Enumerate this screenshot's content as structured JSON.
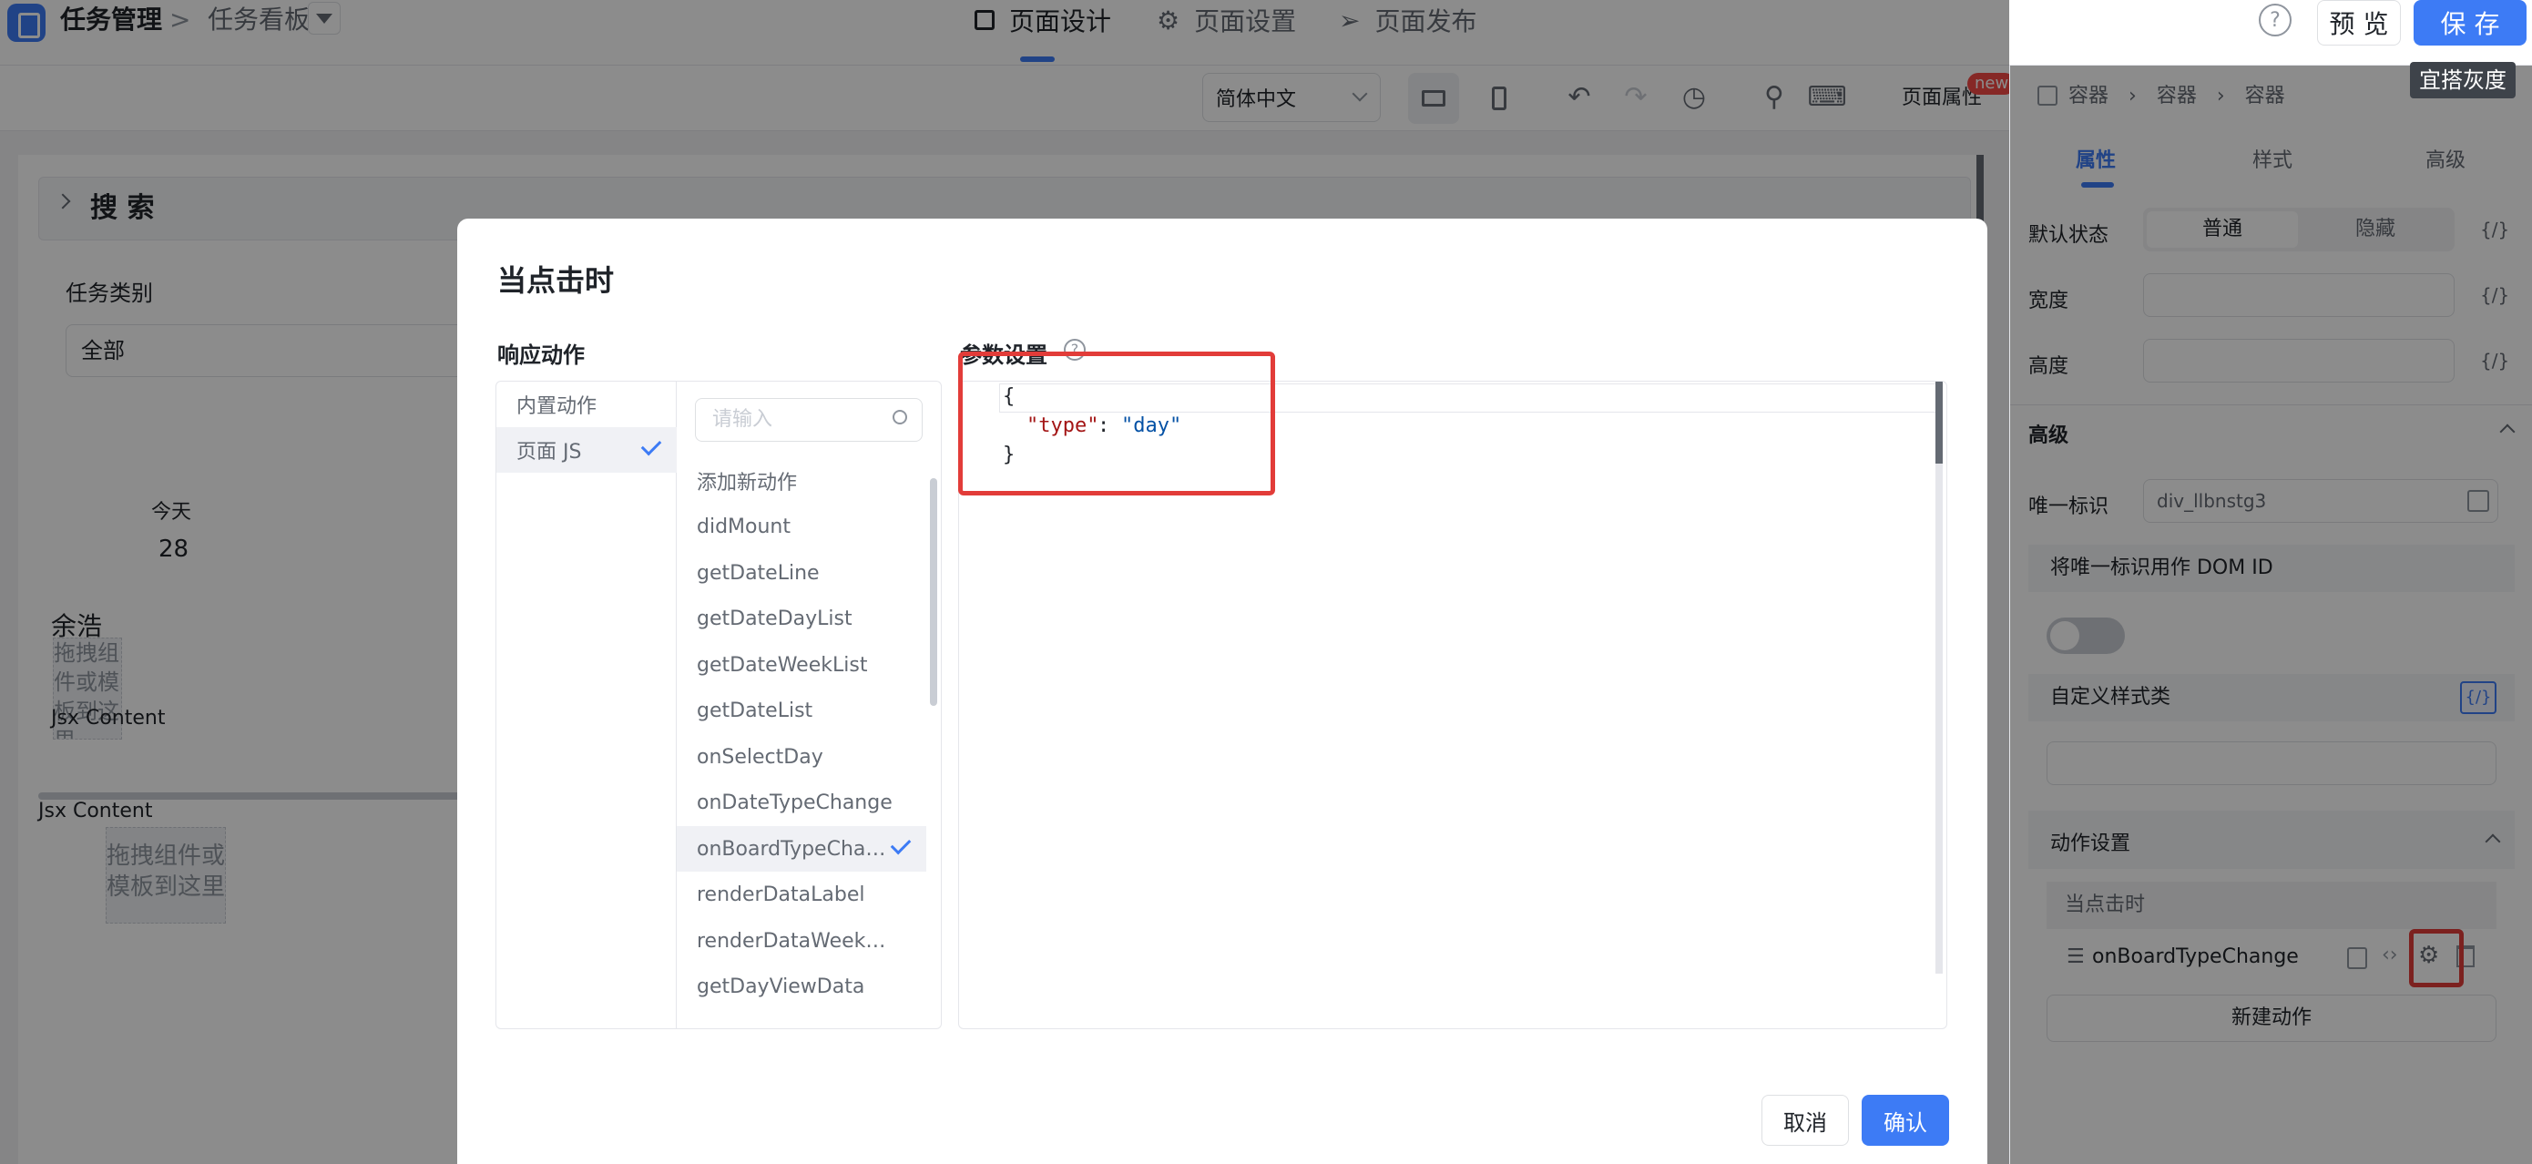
{
  "topbar": {
    "app_name": "任务管理",
    "sep": ">",
    "page_name": "任务看板",
    "tabs": [
      {
        "label": "页面设计",
        "icon": "layout-icon"
      },
      {
        "label": "页面设置",
        "icon": "gear-icon"
      },
      {
        "label": "页面发布",
        "icon": "send-icon"
      }
    ],
    "help": "?",
    "preview_label": "预 览",
    "save_label": "保 存",
    "tag": "宜搭灰度"
  },
  "toolbar": {
    "language": "简体中文",
    "page_props": "页面属性",
    "new_badge": "new"
  },
  "canvas": {
    "search_title": "搜 索",
    "task_type_label": "任务类别",
    "task_type_value": "全部",
    "today_label": "今天",
    "today_num": "28",
    "person": "余浩",
    "drag_text_1": "拖拽组件或模板到这里",
    "jsx1": "Jsx Content",
    "jsx2": "Jsx Content",
    "drag_text_2": "拖拽组件或模板到这里"
  },
  "right_panel": {
    "breadcrumb": [
      "容器",
      "容器",
      "容器"
    ],
    "tabs": [
      "属性",
      "样式",
      "高级"
    ],
    "default_state_label": "默认状态",
    "state_options": [
      "普通",
      "隐藏"
    ],
    "expr": "{/}",
    "width_label": "宽度",
    "height_label": "高度",
    "advanced_title": "高级",
    "uid_label": "唯一标识",
    "uid_value": "div_llbnstg3",
    "dom_id_label": "将唯一标识用作 DOM ID",
    "custom_class_label": "自定义样式类",
    "action_settings": "动作设置",
    "on_click": "当点击时",
    "action_name": "onBoardTypeChange",
    "new_action": "新建动作"
  },
  "modal": {
    "title": "当点击时",
    "response_label": "响应动作",
    "params_label": "参数设置",
    "left_list": [
      "内置动作",
      "页面 JS"
    ],
    "search_placeholder": "请输入",
    "actions": [
      "添加新动作",
      "didMount",
      "getDateLine",
      "getDateDayList",
      "getDateWeekList",
      "getDateList",
      "onSelectDay",
      "onDateTypeChange",
      "onBoardTypeCha…",
      "renderDataLabel",
      "renderDataWeek…",
      "getDayViewData"
    ],
    "code": {
      "open": "{",
      "key": "\"type\"",
      "colon": ": ",
      "value": "\"day\"",
      "close": "}"
    },
    "cancel": "取消",
    "confirm": "确认"
  },
  "colors": {
    "accent": "#3d7bf5",
    "highlight": "#e23c39"
  }
}
